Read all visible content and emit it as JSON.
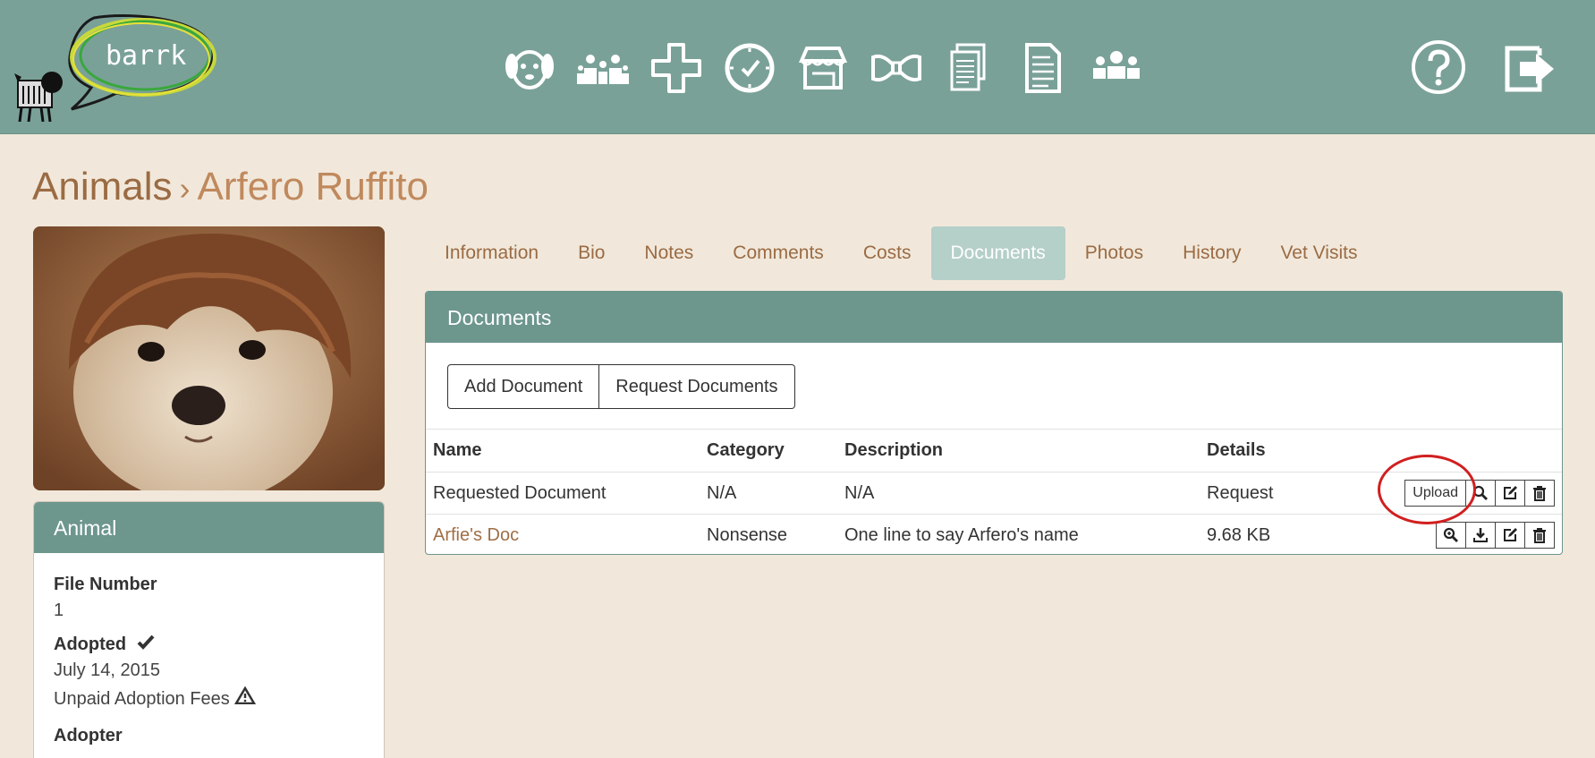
{
  "app": {
    "logo_text": "barrk"
  },
  "nav": {
    "icons": [
      "dog-icon",
      "family-icon",
      "medical-cross-icon",
      "clock-check-icon",
      "store-icon",
      "bow-tie-icon",
      "documents-stack-icon",
      "document-icon",
      "team-icon"
    ],
    "right_icons": [
      "help-icon",
      "logout-icon"
    ]
  },
  "breadcrumb": {
    "root": "Animals",
    "separator": "›",
    "current": "Arfero Ruffito"
  },
  "animal_card": {
    "header": "Animal",
    "file_number_label": "File Number",
    "file_number": "1",
    "adopted_label": "Adopted",
    "adopted_date": "July 14, 2015",
    "fees_text": "Unpaid Adoption Fees",
    "adopter_label": "Adopter"
  },
  "tabs": [
    {
      "label": "Information",
      "active": false
    },
    {
      "label": "Bio",
      "active": false
    },
    {
      "label": "Notes",
      "active": false
    },
    {
      "label": "Comments",
      "active": false
    },
    {
      "label": "Costs",
      "active": false
    },
    {
      "label": "Documents",
      "active": true
    },
    {
      "label": "Photos",
      "active": false
    },
    {
      "label": "History",
      "active": false
    },
    {
      "label": "Vet Visits",
      "active": false
    }
  ],
  "documents": {
    "title": "Documents",
    "add_button": "Add Document",
    "request_button": "Request Documents",
    "columns": {
      "name": "Name",
      "category": "Category",
      "description": "Description",
      "details": "Details"
    },
    "rows": [
      {
        "name": "Requested Document",
        "category": "N/A",
        "description": "N/A",
        "details": "Request",
        "upload_label": "Upload"
      },
      {
        "name": "Arfie's Doc",
        "category": "Nonsense",
        "description": "One line to say Arfero's name",
        "details": "9.68 KB"
      }
    ]
  },
  "colors": {
    "header_bg": "#7aa198",
    "panel_header": "#6d968d",
    "page_bg": "#f1e8db",
    "link": "#a06e45",
    "highlight": "#d11f1f"
  }
}
